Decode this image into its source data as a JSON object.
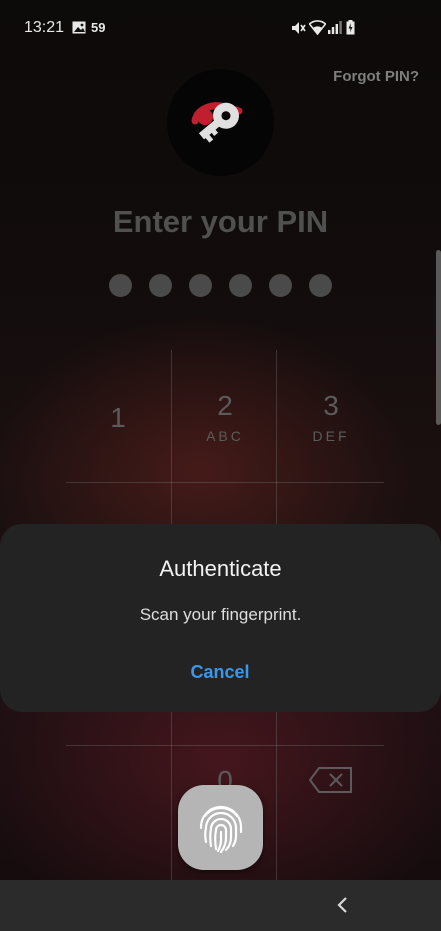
{
  "status_bar": {
    "time": "13:21",
    "notification_count": "59"
  },
  "lock": {
    "forgot_label": "Forgot PIN?",
    "title": "Enter your PIN",
    "pin_dots": 6
  },
  "keypad": {
    "keys": [
      {
        "num": "1",
        "letters": ""
      },
      {
        "num": "2",
        "letters": "ABC"
      },
      {
        "num": "3",
        "letters": "DEF"
      },
      {
        "num": "0",
        "letters": ""
      }
    ]
  },
  "dialog": {
    "title": "Authenticate",
    "message": "Scan your fingerprint.",
    "cancel_label": "Cancel"
  },
  "colors": {
    "accent": "#3d97e8",
    "logo_accent": "#c0202e"
  }
}
